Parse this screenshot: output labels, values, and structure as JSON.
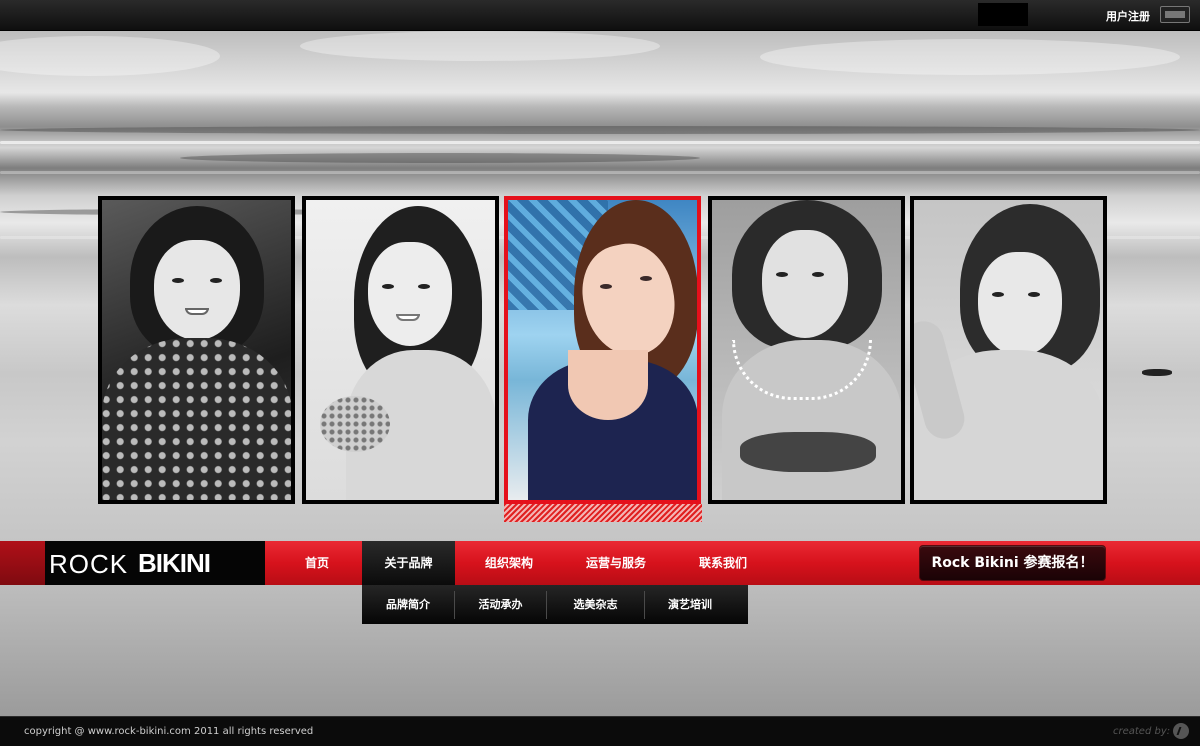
{
  "topbar": {
    "register_label": "用户注册",
    "menu_toggle_icon": "menu-toggle-icon"
  },
  "photos": [
    {
      "id": "photo-1",
      "state": "grayscale"
    },
    {
      "id": "photo-2",
      "state": "grayscale"
    },
    {
      "id": "photo-3",
      "state": "color-selected"
    },
    {
      "id": "photo-4",
      "state": "grayscale"
    },
    {
      "id": "photo-5",
      "state": "grayscale"
    }
  ],
  "nav": {
    "logo_rock": "ROCK",
    "logo_bikini": "BIKINI",
    "items": [
      {
        "label": "首页"
      },
      {
        "label": "关于品牌",
        "active": true
      },
      {
        "label": "组织架构"
      },
      {
        "label": "运营与服务"
      },
      {
        "label": "联系我们"
      }
    ],
    "cta_label": "Rock Bikini 参赛报名！"
  },
  "submenu": {
    "items": [
      {
        "label": "品牌简介"
      },
      {
        "label": "活动承办"
      },
      {
        "label": "选美杂志"
      },
      {
        "label": "演艺培训"
      }
    ]
  },
  "footer": {
    "copyright": "copyright @ www.rock-bikini.com 2011 all rights reserved",
    "created_by": "created by:",
    "created_icon": "creator-logo-icon"
  },
  "colors": {
    "accent_red": "#e5101b",
    "nav_dark": "#0b0b0b",
    "cta_bg": "#2a060a"
  }
}
